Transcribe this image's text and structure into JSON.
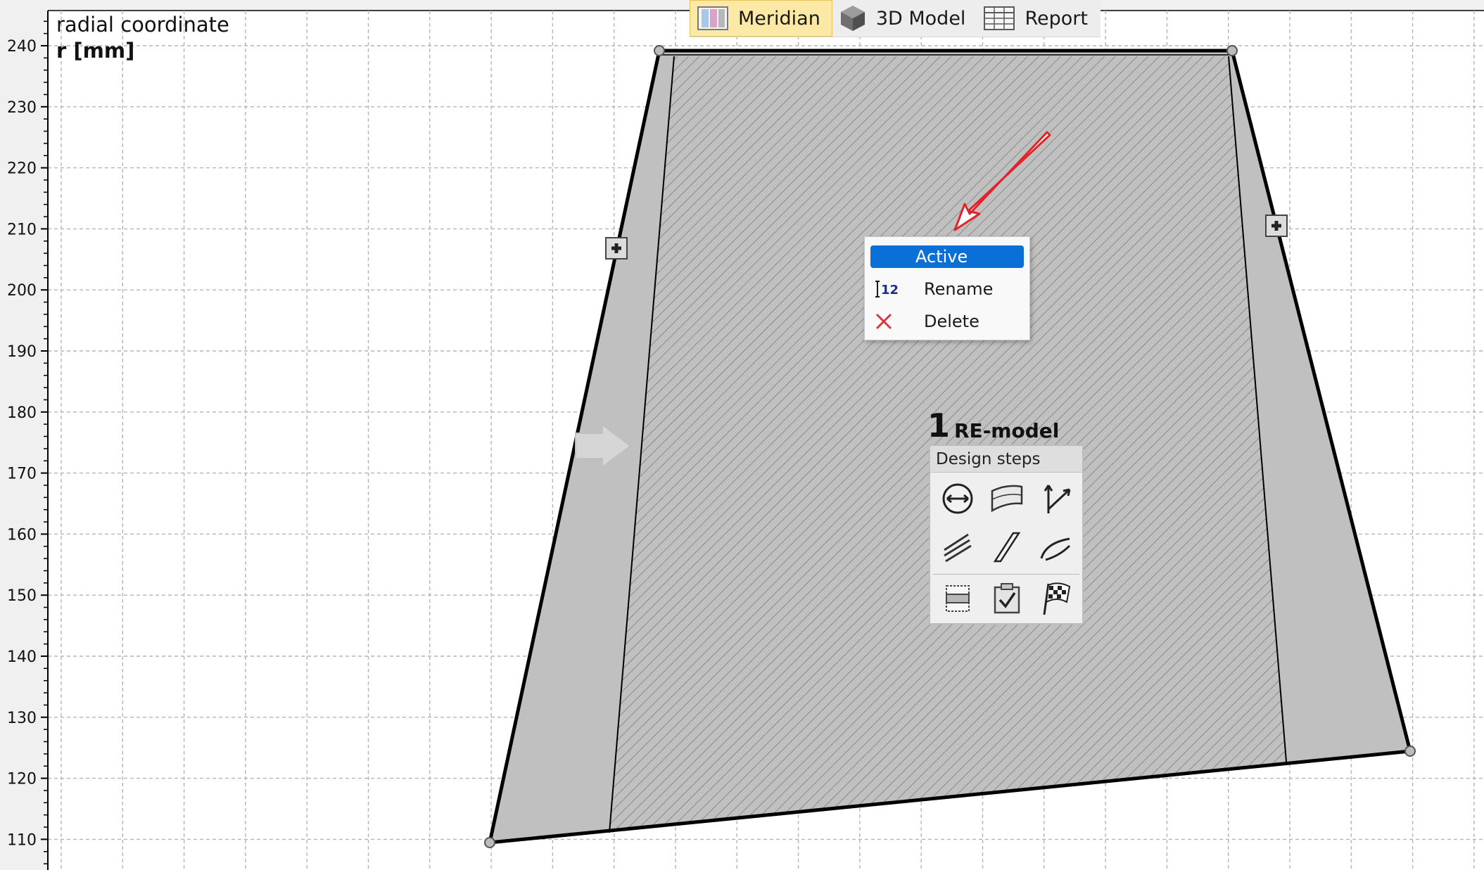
{
  "axis": {
    "label_line1": "radial coordinate",
    "label_line2": "r [mm]",
    "y_ticks": [
      "240",
      "230",
      "220",
      "210",
      "200",
      "190",
      "180",
      "170",
      "160",
      "150",
      "140",
      "130",
      "120",
      "110"
    ],
    "y_tick_values": [
      240,
      230,
      220,
      210,
      200,
      190,
      180,
      170,
      160,
      150,
      140,
      130,
      120,
      110
    ]
  },
  "view_tabs": [
    {
      "label": "Meridian",
      "icon": "meridian-icon",
      "active": true
    },
    {
      "label": "3D Model",
      "icon": "cube-icon",
      "active": false
    },
    {
      "label": "Report",
      "icon": "table-icon",
      "active": false
    }
  ],
  "context_menu": {
    "items": [
      {
        "label": "Active",
        "icon": "",
        "highlighted": true
      },
      {
        "label": "Rename",
        "icon": "rename-icon",
        "highlighted": false
      },
      {
        "label": "Delete",
        "icon": "delete-icon",
        "highlighted": false
      }
    ]
  },
  "model": {
    "number": "1",
    "name": "RE-model"
  },
  "design_steps": {
    "title": "Design steps",
    "buttons": [
      "main-dimensions-icon",
      "meridian-contour-icon",
      "blade-angles-icon",
      "blade-lean-icon",
      "blade-thickness-icon",
      "blade-edges-icon",
      "layout-icon",
      "check-icon",
      "finish-flag-icon"
    ]
  },
  "colors": {
    "background": "#f0f0f0",
    "grid": "#b4b4b4",
    "shape_fill": "#c0c0c0",
    "hatch": "#8a8a8a",
    "outline": "#000000",
    "active_highlight": "#0a6fd6",
    "arrow": "#e0252a",
    "tab_active": "#fde9a6",
    "delete_red": "#d9363b",
    "rename_blue": "#1a2f8a"
  }
}
